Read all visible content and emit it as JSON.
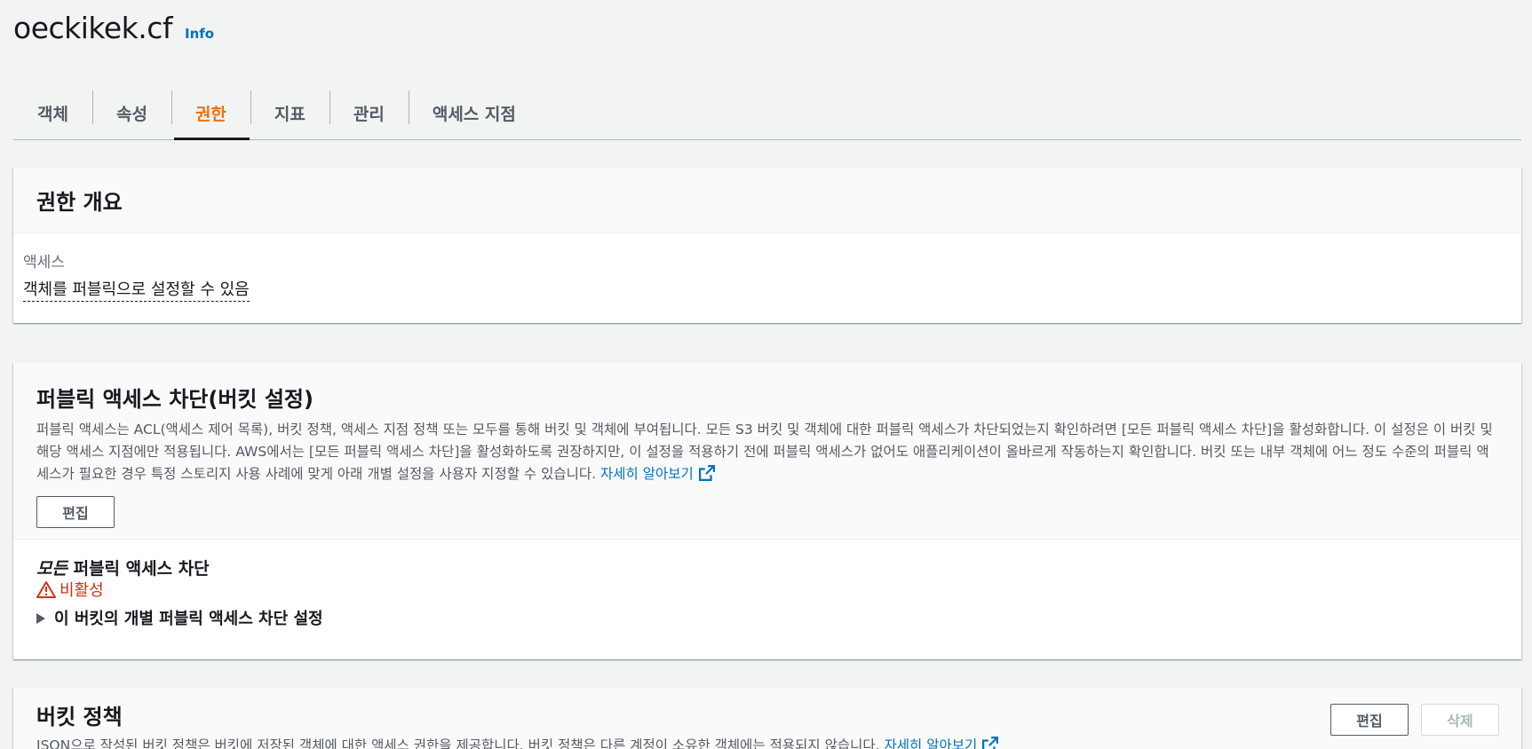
{
  "header": {
    "title": "oeckikek.cf",
    "info_label": "Info"
  },
  "tabs": [
    {
      "label": "객체",
      "active": false
    },
    {
      "label": "속성",
      "active": false
    },
    {
      "label": "권한",
      "active": true
    },
    {
      "label": "지표",
      "active": false
    },
    {
      "label": "관리",
      "active": false
    },
    {
      "label": "액세스 지점",
      "active": false
    }
  ],
  "overview": {
    "title": "권한 개요",
    "access_label": "액세스",
    "access_value": "객체를 퍼블릭으로 설정할 수 있음"
  },
  "block_public_access": {
    "title": "퍼블릭 액세스 차단(버킷 설정)",
    "description": "퍼블릭 액세스는 ACL(액세스 제어 목록), 버킷 정책, 액세스 지점 정책 또는 모두를 통해 버킷 및 객체에 부여됩니다. 모든 S3 버킷 및 객체에 대한 퍼블릭 액세스가 차단되었는지 확인하려면 [모든 퍼블릭 액세스 차단]을 활성화합니다. 이 설정은 이 버킷 및 해당 액세스 지점에만 적용됩니다. AWS에서는 [모든 퍼블릭 액세스 차단]을 활성화하도록 권장하지만, 이 설정을 적용하기 전에 퍼블릭 액세스가 없어도 애플리케이션이 올바르게 작동하는지 확인합니다. 버킷 또는 내부 객체에 어느 정도 수준의 퍼블릭 액세스가 필요한 경우 특정 스토리지 사용 사례에 맞게 아래 개별 설정을 사용자 지정할 수 있습니다.",
    "learn_more": "자세히 알아보기",
    "edit_label": "편집",
    "setting_title_emphasis": "모든",
    "setting_title_rest": " 퍼블릭 액세스 차단",
    "status": "비활성",
    "expander_label": "이 버킷의 개별 퍼블릭 액세스 차단 설정"
  },
  "bucket_policy": {
    "title": "버킷 정책",
    "description": "JSON으로 작성된 버킷 정책은 버킷에 저장된 객체에 대한 액세스 권한을 제공합니다. 버킷 정책은 다른 계정이 소유한 객체에는 적용되지 않습니다.",
    "learn_more": "자세히 알아보기",
    "edit_label": "편집",
    "delete_label": "삭제"
  },
  "colors": {
    "accent_tab": "#ec7211",
    "link": "#0073bb",
    "warning": "#d13212"
  }
}
